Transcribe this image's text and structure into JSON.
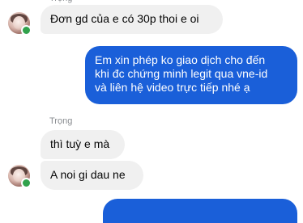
{
  "conversation": {
    "sender_name": "Trọng",
    "colors": {
      "incoming_bubble": "#f0f0f0",
      "outgoing_bubble": "#1a5fd9",
      "online_status": "#31a24c"
    },
    "messages": [
      {
        "direction": "incoming",
        "text": "Đơn gd của e có 30p thoi e oi"
      },
      {
        "direction": "outgoing",
        "lines": [
          "Em xin phép ko giao dịch cho đến",
          "khi đc chứng minh legit qua vne-id",
          "và liên hệ video trực tiếp nhé ạ"
        ]
      },
      {
        "direction": "incoming",
        "text": "thì tuỳ e mà"
      },
      {
        "direction": "incoming",
        "text": "A noi gi dau ne"
      }
    ]
  }
}
